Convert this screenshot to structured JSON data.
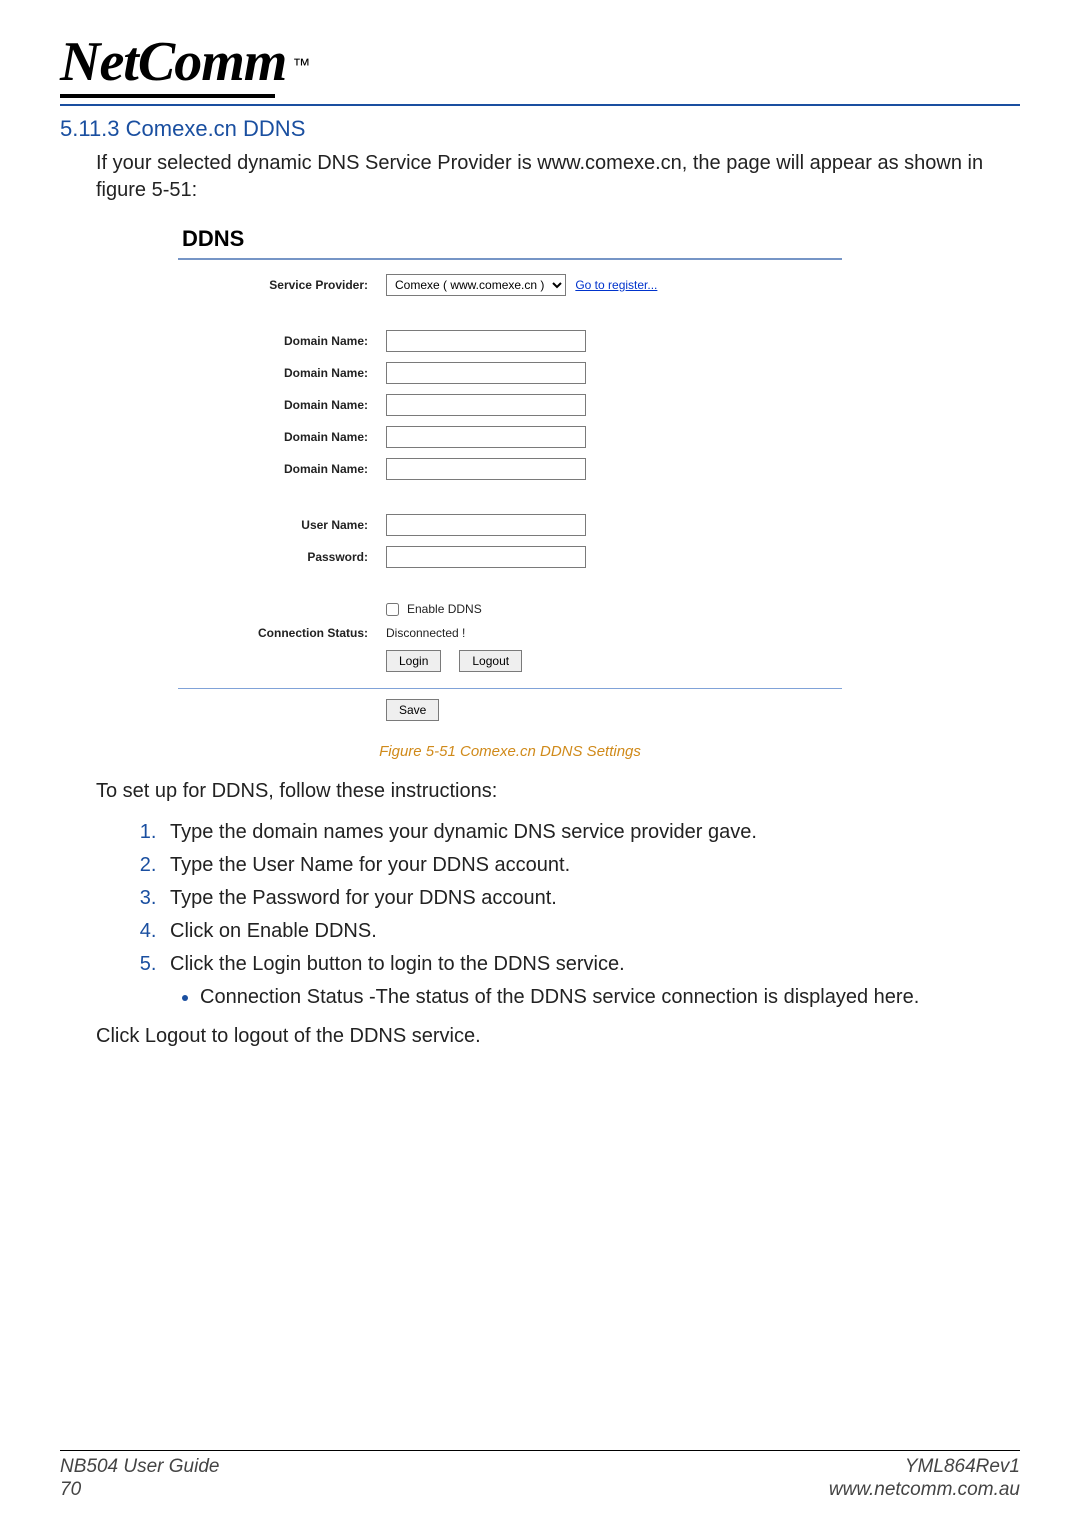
{
  "logo": {
    "brand": "NetComm",
    "tm": "™"
  },
  "section": {
    "number_title": "5.11.3 Comexe.cn DDNS",
    "intro": "If your selected dynamic DNS Service Provider is www.comexe.cn, the page will appear as shown in figure 5-51:"
  },
  "panel": {
    "title": "DDNS",
    "service_provider_label": "Service Provider:",
    "service_provider_option": "Comexe ( www.comexe.cn )",
    "register_link": "Go to register...",
    "domain_name_label": "Domain Name:",
    "domain_values": [
      "",
      "",
      "",
      "",
      ""
    ],
    "user_name_label": "User Name:",
    "user_name_value": "",
    "password_label": "Password:",
    "password_value": "",
    "enable_label": "Enable DDNS",
    "enable_checked": false,
    "conn_status_label": "Connection Status:",
    "conn_status_value": "Disconnected !",
    "login_btn": "Login",
    "logout_btn": "Logout",
    "save_btn": "Save"
  },
  "figure_caption": "Figure 5-51 Comexe.cn DDNS Settings",
  "instructions": {
    "lead": "To set up for DDNS, follow these instructions:",
    "steps": [
      "Type the domain names your dynamic DNS service provider gave.",
      "Type the User Name for your DDNS account.",
      "Type the Password for your DDNS account.",
      "Click on Enable DDNS.",
      "Click the Login button to login to the DDNS service."
    ],
    "sub_bullet": "Connection Status -The status of the DDNS service connection is displayed here.",
    "outro": "Click Logout to logout of the DDNS service."
  },
  "footer": {
    "left_top": "NB504 User Guide",
    "left_bottom": "70",
    "right_top": "YML864Rev1",
    "right_bottom": "www.netcomm.com.au"
  }
}
